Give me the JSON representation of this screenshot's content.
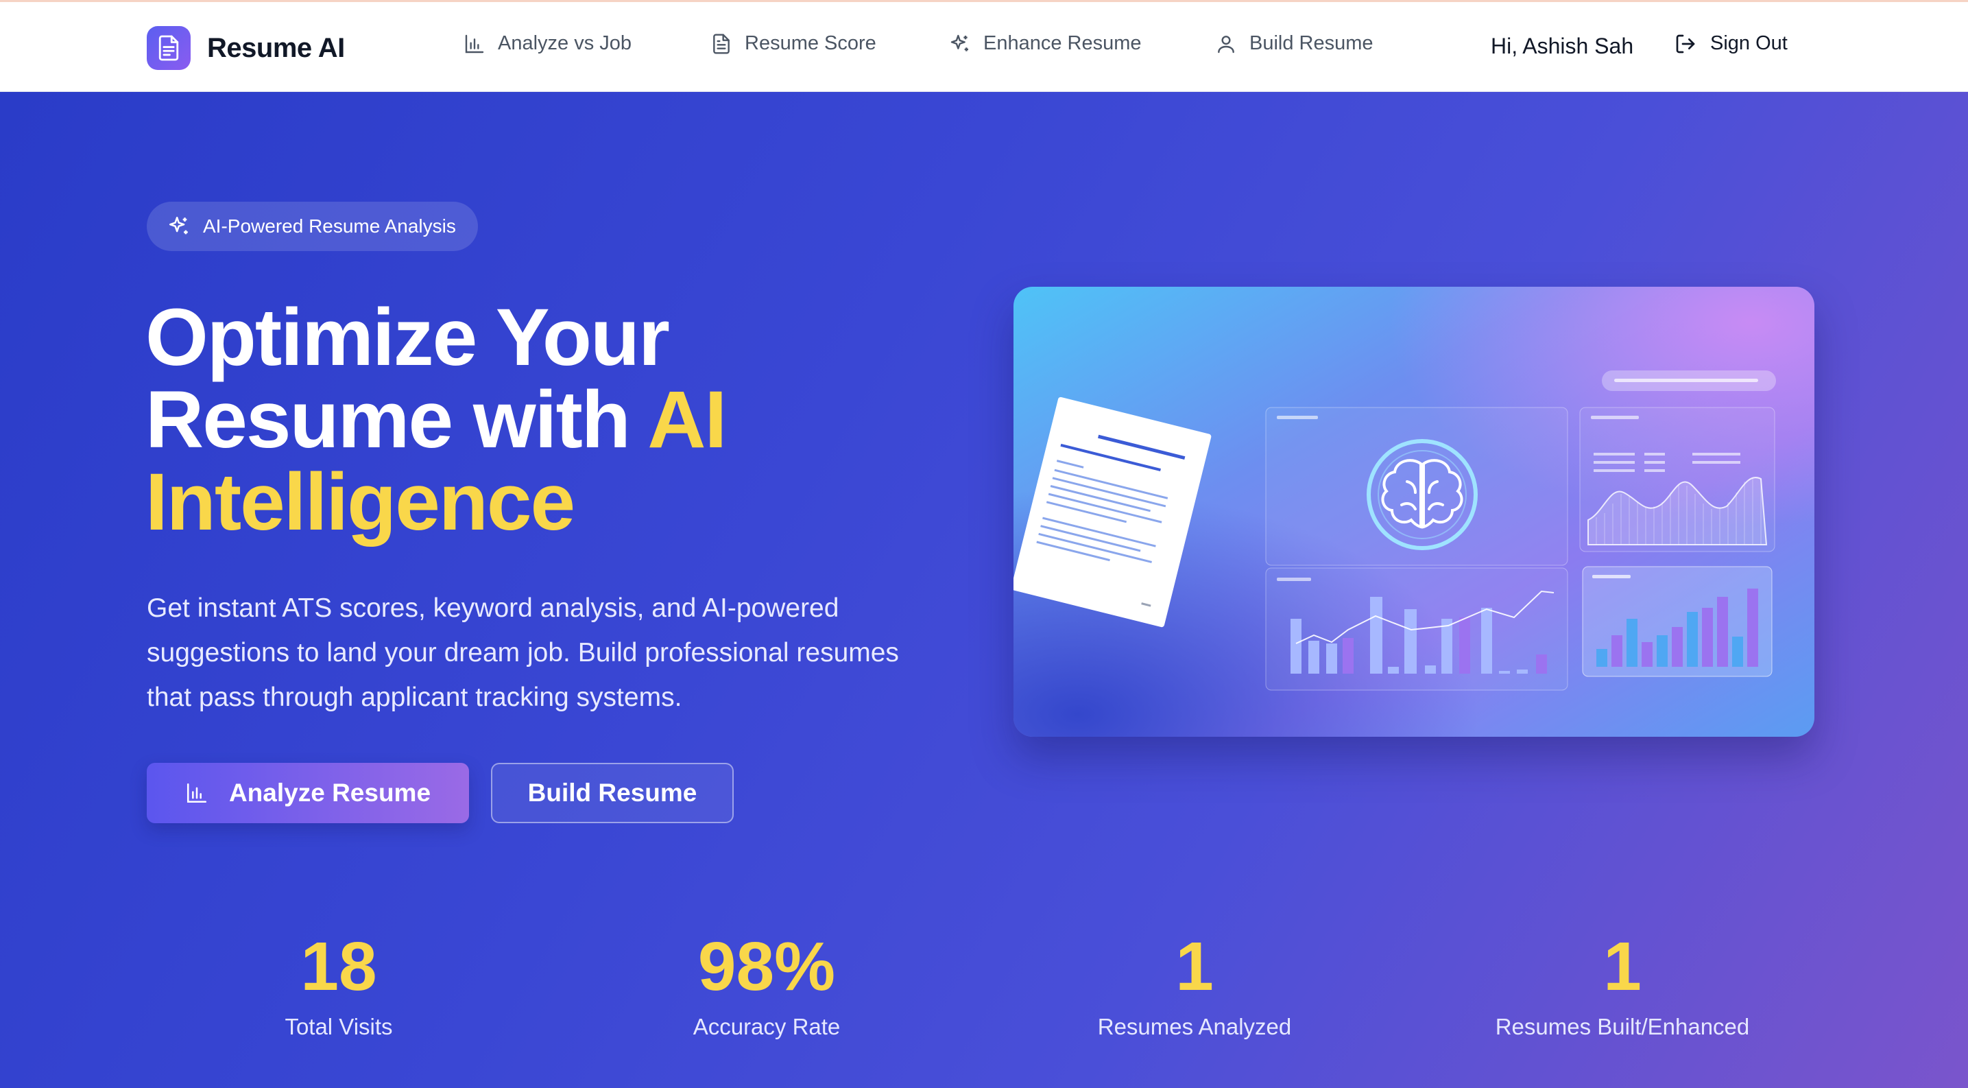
{
  "brand": {
    "name": "Resume AI"
  },
  "nav": {
    "items": [
      {
        "label": "Analyze vs Job",
        "icon": "bar-chart-icon"
      },
      {
        "label": "Resume Score",
        "icon": "document-icon"
      },
      {
        "label": "Enhance Resume",
        "icon": "sparkles-icon"
      },
      {
        "label": "Build Resume",
        "icon": "user-icon"
      }
    ],
    "greeting": "Hi, Ashish Sah",
    "signout_label": "Sign Out"
  },
  "hero": {
    "badge": "AI-Powered Resume Analysis",
    "headline_line1": "Optimize Your",
    "headline_line2": "Resume with ",
    "headline_highlight1": "AI",
    "headline_highlight2": "Intelligence",
    "subtitle": "Get instant ATS scores, keyword analysis, and AI-powered suggestions to land your dream job. Build professional resumes that pass through applicant tracking systems.",
    "primary_button": "Analyze Resume",
    "secondary_button": "Build Resume"
  },
  "stats": [
    {
      "value": "18",
      "label": "Total Visits"
    },
    {
      "value": "98%",
      "label": "Accuracy Rate"
    },
    {
      "value": "1",
      "label": "Resumes Analyzed"
    },
    {
      "value": "1",
      "label": "Resumes Built/Enhanced"
    }
  ],
  "colors": {
    "accent_yellow": "#f9d74a",
    "brand_purple": "#6a5cf0",
    "hero_bg": "#3b3fcf"
  }
}
